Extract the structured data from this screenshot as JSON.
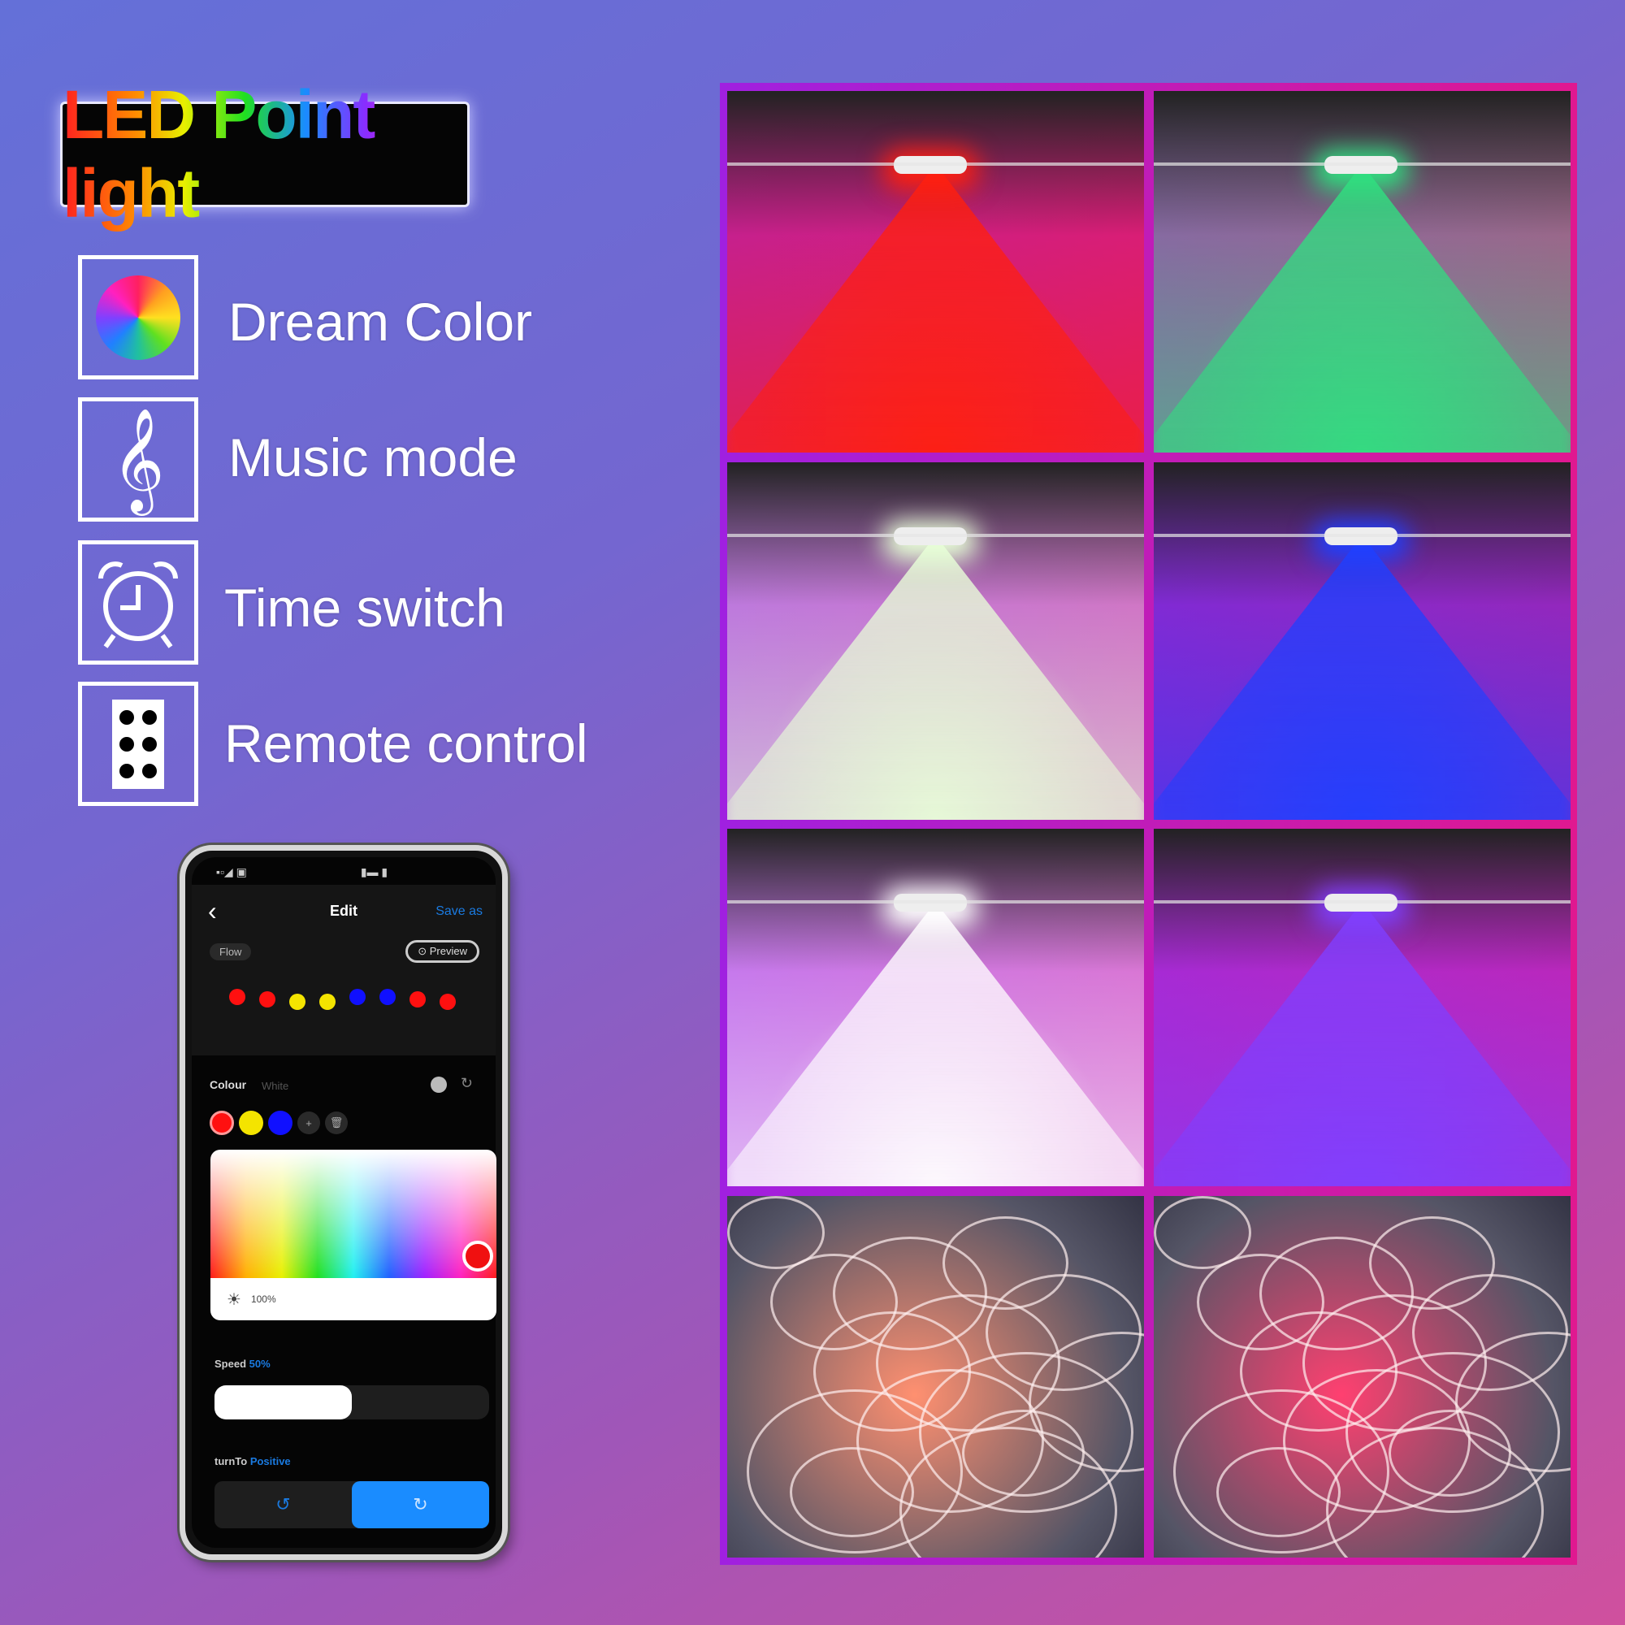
{
  "title": "LED Point light",
  "features": [
    {
      "label": "Dream Color",
      "icon": "color-wheel-icon"
    },
    {
      "label": "Music mode",
      "icon": "treble-clef-icon"
    },
    {
      "label": "Time switch",
      "icon": "alarm-clock-icon"
    },
    {
      "label": "Remote control",
      "icon": "remote-control-icon"
    }
  ],
  "phone": {
    "header_title": "Edit",
    "back": "‹",
    "save_as": "Save as",
    "mode_pill": "Flow",
    "preview": "Preview",
    "led_dots": [
      "#ff1010",
      "#ff1010",
      "#f4e400",
      "#f4e400",
      "#1010ff",
      "#1010ff",
      "#ff1010",
      "#ff1010"
    ],
    "tab_colour": "Colour",
    "tab_white": "White",
    "swatches": [
      "#ff1010",
      "#f4e400",
      "#1010ff"
    ],
    "brightness": "100%",
    "speed_label": "Speed",
    "speed_value": "50%",
    "speed_fraction": 0.5,
    "direction_label": "turnTo",
    "direction_value": "Positive",
    "accent": "#1a8cff"
  },
  "photos": [
    {
      "name": "red-light-photo",
      "color": "#ff2010"
    },
    {
      "name": "green-light-photo",
      "color": "#30e080"
    },
    {
      "name": "warm-white-light-photo",
      "color": "#e8ffd8"
    },
    {
      "name": "blue-light-photo",
      "color": "#2040ff"
    },
    {
      "name": "white-light-photo",
      "color": "#ffffff"
    },
    {
      "name": "purple-light-photo",
      "color": "#8040ff"
    },
    {
      "name": "light-string-warm-photo",
      "color": "#ff9070"
    },
    {
      "name": "light-string-rgb-photo",
      "color": "#ff4070"
    }
  ]
}
